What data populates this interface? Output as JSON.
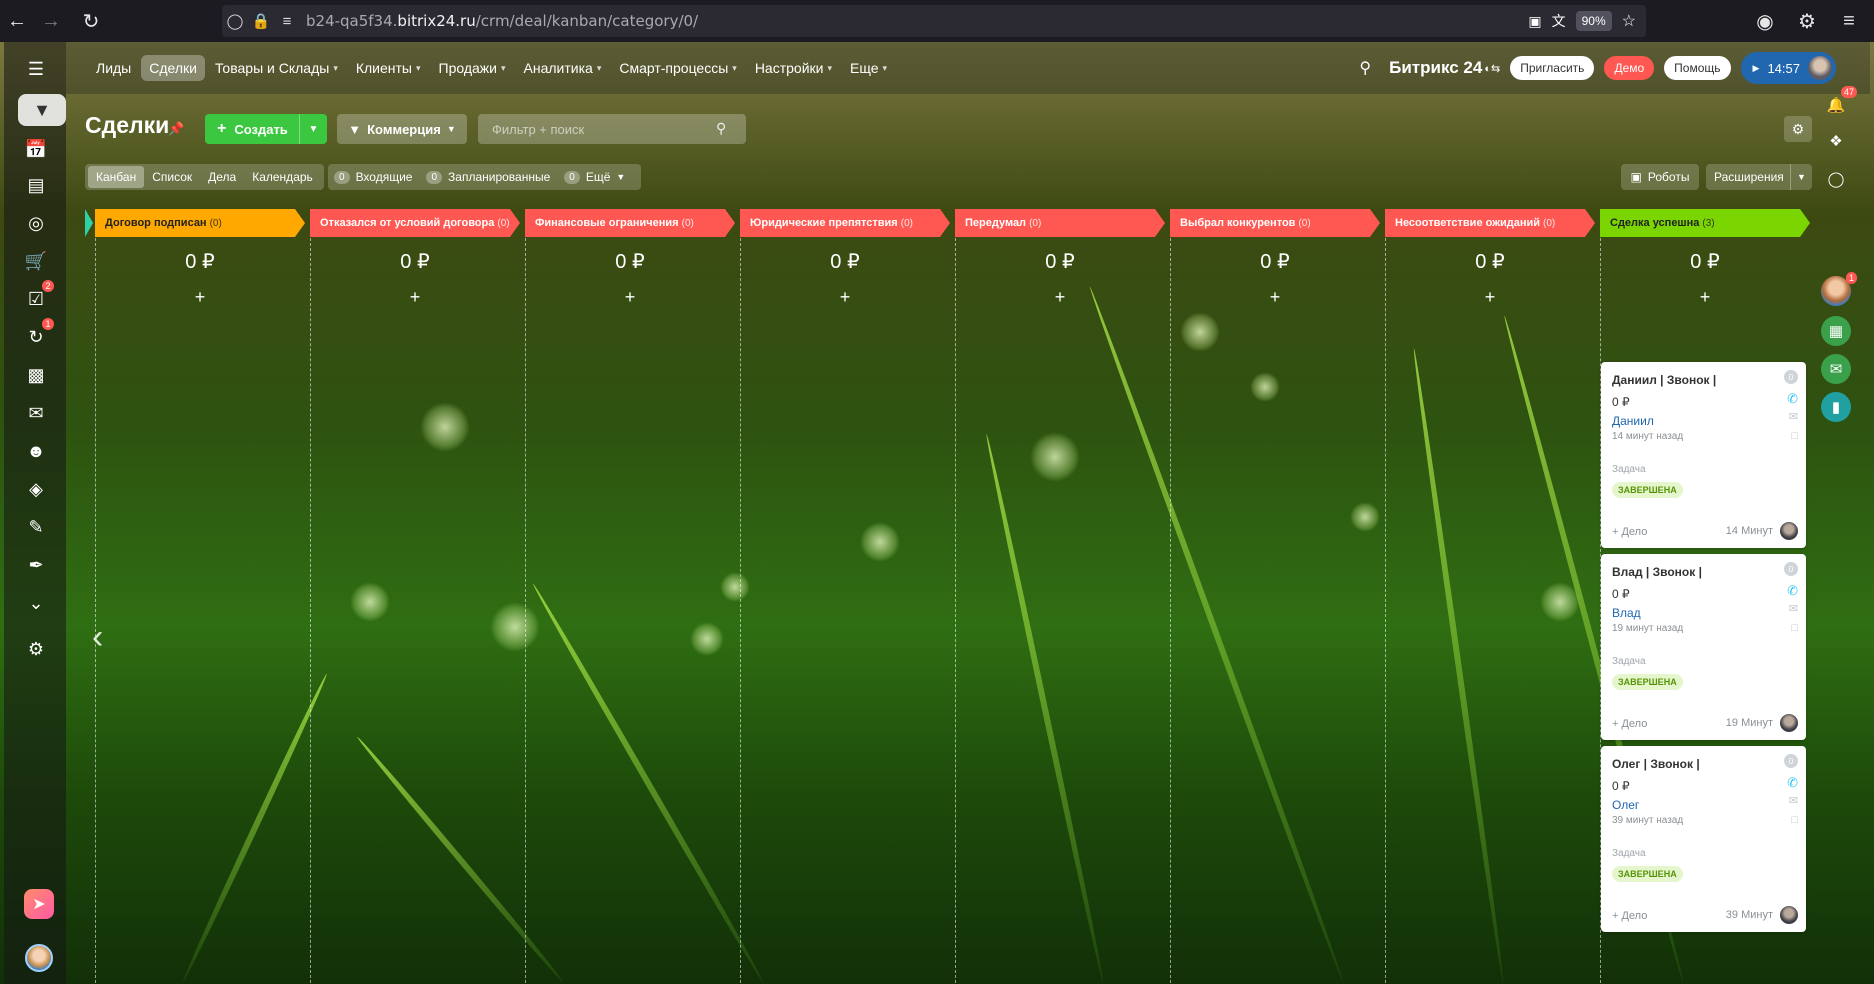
{
  "browser": {
    "url_prefix": "b24-qa5f34.",
    "url_domain": "bitrix24.ru",
    "url_path": "/crm/deal/kanban/category/0/",
    "zoom": "90%"
  },
  "topmenu": {
    "items": [
      {
        "label": "Лиды",
        "chev": false,
        "active": false
      },
      {
        "label": "Сделки",
        "chev": false,
        "active": true
      },
      {
        "label": "Товары и Склады",
        "chev": true,
        "active": false
      },
      {
        "label": "Клиенты",
        "chev": true,
        "active": false
      },
      {
        "label": "Продажи",
        "chev": true,
        "active": false
      },
      {
        "label": "Аналитика",
        "chev": true,
        "active": false
      },
      {
        "label": "Смарт-процессы",
        "chev": true,
        "active": false
      },
      {
        "label": "Настройки",
        "chev": true,
        "active": false
      },
      {
        "label": "Еще",
        "chev": true,
        "active": false
      }
    ],
    "logo": "Битрикс 24",
    "invite": "Пригласить",
    "demo": "Демо",
    "help": "Помощь",
    "time": "14:57"
  },
  "leftbar": {
    "badges": {
      "tasks": "2",
      "automation": "1"
    }
  },
  "rightbar": {
    "notifications": "47",
    "avatar_badge": "1"
  },
  "header": {
    "title": "Сделки",
    "create_label": "Создать",
    "pipeline_label": "Коммерция",
    "search_placeholder": "Фильтр + поиск"
  },
  "views": [
    "Канбан",
    "Список",
    "Дела",
    "Календарь"
  ],
  "counters": [
    {
      "num": "0",
      "label": "Входящие"
    },
    {
      "num": "0",
      "label": "Запланированные"
    },
    {
      "num": "0",
      "label": "Ещё"
    }
  ],
  "robots_label": "Роботы",
  "extensions_label": "Расширения",
  "columns": [
    {
      "name": "Договор подписан",
      "count": "(0)",
      "total": "0 ₽",
      "color": "#ffa900",
      "dark": true
    },
    {
      "name": "Отказался от условий договора",
      "count": "(0)",
      "total": "0 ₽",
      "color": "#ff5752",
      "dark": false
    },
    {
      "name": "Финансовые ограничения",
      "count": "(0)",
      "total": "0 ₽",
      "color": "#ff5752",
      "dark": false
    },
    {
      "name": "Юридические препятствия",
      "count": "(0)",
      "total": "0 ₽",
      "color": "#ff5752",
      "dark": false
    },
    {
      "name": "Передумал",
      "count": "(0)",
      "total": "0 ₽",
      "color": "#ff5752",
      "dark": false
    },
    {
      "name": "Выбрал конкурентов",
      "count": "(0)",
      "total": "0 ₽",
      "color": "#ff5752",
      "dark": false
    },
    {
      "name": "Несоответствие ожиданий",
      "count": "(0)",
      "total": "0 ₽",
      "color": "#ff5752",
      "dark": false
    },
    {
      "name": "Сделка успешна",
      "count": "(3)",
      "total": "0 ₽",
      "color": "#7bd500",
      "dark": true
    }
  ],
  "cards": [
    {
      "title": "Даниил | Звонок |",
      "sum": "0 ₽",
      "client": "Даниил",
      "ago": "14 минут назад",
      "task": "Задача",
      "status": "ЗАВЕРШЕНА",
      "add": "+ Дело",
      "time": "14 Минут"
    },
    {
      "title": "Влад | Звонок |",
      "sum": "0 ₽",
      "client": "Влад",
      "ago": "19 минут назад",
      "task": "Задача",
      "status": "ЗАВЕРШЕНА",
      "add": "+ Дело",
      "time": "19 Минут"
    },
    {
      "title": "Олег | Звонок |",
      "sum": "0 ₽",
      "client": "Олег",
      "ago": "39 минут назад",
      "task": "Задача",
      "status": "ЗАВЕРШЕНА",
      "add": "+ Дело",
      "time": "39 Минут"
    }
  ]
}
